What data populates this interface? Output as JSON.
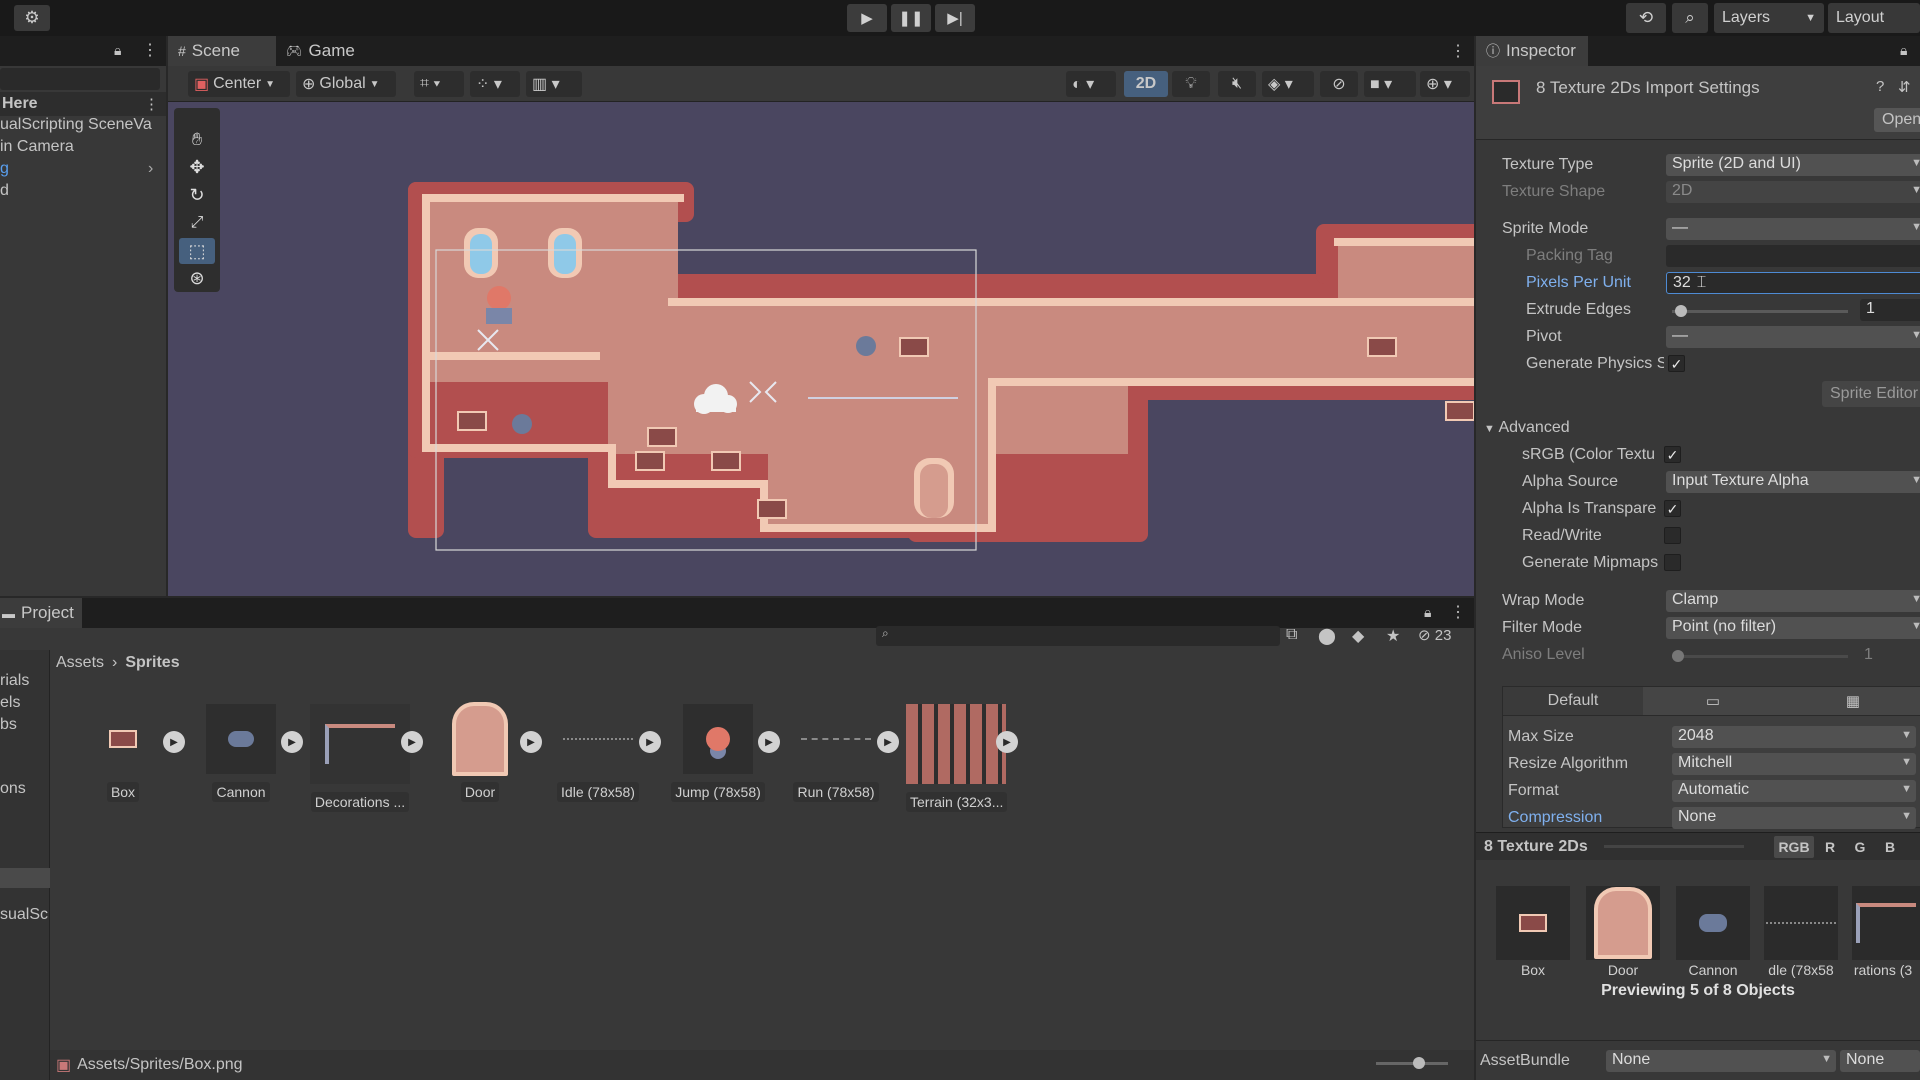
{
  "topbar": {
    "layers_label": "Layers",
    "layout_label": "Layout"
  },
  "hierarchy": {
    "items": [
      "Here",
      "ualScripting SceneVa",
      "in Camera",
      "g",
      "d"
    ]
  },
  "scene": {
    "tabs": [
      {
        "label": "Scene",
        "icon": "grid-icon"
      },
      {
        "label": "Game",
        "icon": "gamepad-icon"
      }
    ],
    "pivot_label": "Center",
    "space_label": "Global",
    "mode_2d_label": "2D"
  },
  "project": {
    "tab_label": "Project",
    "search_placeholder": "",
    "hidden_count": "23",
    "breadcrumb": [
      "Assets",
      "Sprites"
    ],
    "left_items": [
      "rials",
      "els",
      "bs",
      "ons",
      "sualSc"
    ],
    "assets": [
      {
        "name": "Box"
      },
      {
        "name": "Cannon"
      },
      {
        "name": "Decorations ..."
      },
      {
        "name": "Door"
      },
      {
        "name": "Idle (78x58)"
      },
      {
        "name": "Jump (78x58)"
      },
      {
        "name": "Run (78x58)"
      },
      {
        "name": "Terrain (32x3..."
      }
    ],
    "status_path": "Assets/Sprites/Box.png",
    "zoom_level": 0.6
  },
  "inspector": {
    "tab_label": "Inspector",
    "title": "8 Texture 2Ds Import Settings",
    "open_button": "Open",
    "texture_type": {
      "label": "Texture Type",
      "value": "Sprite (2D and UI)"
    },
    "texture_shape": {
      "label": "Texture Shape",
      "value": "2D"
    },
    "sprite_mode": {
      "label": "Sprite Mode",
      "value": "—"
    },
    "packing_tag": {
      "label": "Packing Tag",
      "value": ""
    },
    "pixels_per_unit": {
      "label": "Pixels Per Unit",
      "value": "32"
    },
    "extrude_edges": {
      "label": "Extrude Edges",
      "value": "1",
      "slider": 0.03
    },
    "pivot": {
      "label": "Pivot",
      "value": "—"
    },
    "generate_physics": {
      "label": "Generate Physics S",
      "checked": true
    },
    "sprite_editor_button": "Sprite Editor",
    "advanced": {
      "label": "Advanced",
      "srgb": {
        "label": "sRGB (Color Textu",
        "checked": true
      },
      "alpha_source": {
        "label": "Alpha Source",
        "value": "Input Texture Alpha"
      },
      "alpha_transparency": {
        "label": "Alpha Is Transpare",
        "checked": true
      },
      "read_write": {
        "label": "Read/Write",
        "checked": false
      },
      "generate_mipmaps": {
        "label": "Generate Mipmaps",
        "checked": false
      }
    },
    "wrap_mode": {
      "label": "Wrap Mode",
      "value": "Clamp"
    },
    "filter_mode": {
      "label": "Filter Mode",
      "value": "Point (no filter)"
    },
    "aniso_level": {
      "label": "Aniso Level",
      "value": "1"
    },
    "platform_tabs": [
      {
        "label": "Default"
      },
      {
        "icon": "monitor-icon"
      },
      {
        "icon": "grid-icon"
      }
    ],
    "max_size": {
      "label": "Max Size",
      "value": "2048"
    },
    "resize_algorithm": {
      "label": "Resize Algorithm",
      "value": "Mitchell"
    },
    "format": {
      "label": "Format",
      "value": "Automatic"
    },
    "compression": {
      "label": "Compression",
      "value": "None"
    },
    "preview": {
      "title": "8 Texture 2Ds",
      "channels": [
        "RGB",
        "R",
        "G",
        "B"
      ],
      "items": [
        "Box",
        "Door",
        "Cannon",
        "dle (78x58",
        "rations (3"
      ],
      "caption": "Previewing 5 of 8 Objects"
    },
    "assetbundle": {
      "label": "AssetBundle",
      "value": "None",
      "variant": "None"
    }
  },
  "colors": {
    "brick": "#c98a7f",
    "brick_border": "#b24f4f",
    "trim": "#f1c9b4",
    "viewport_bg": "#4a4660",
    "accent_blue": "#4e8bd4"
  }
}
